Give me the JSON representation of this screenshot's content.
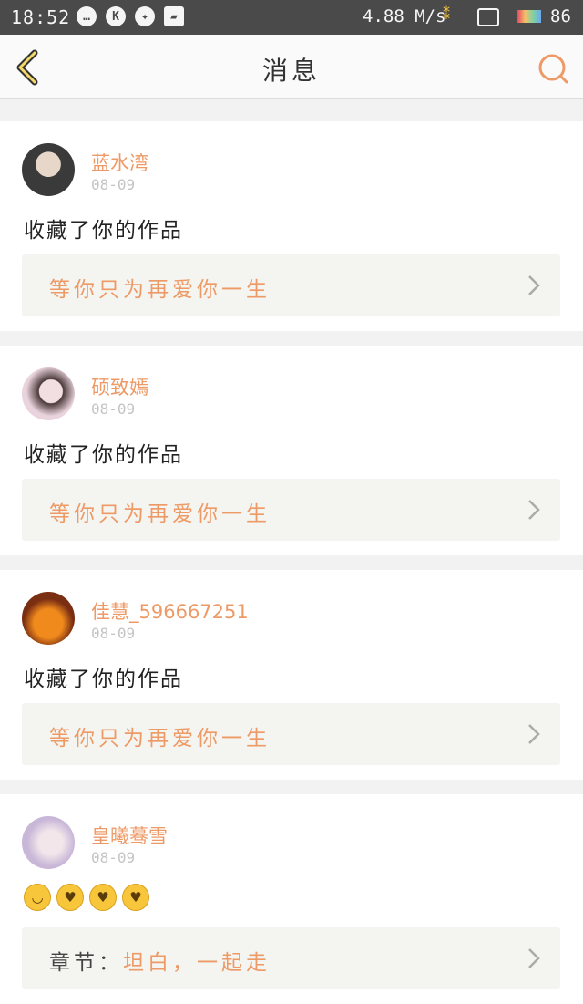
{
  "status_bar": {
    "time": "18:52",
    "net_speed": "4.88 M/s",
    "battery": "86",
    "icons": [
      "chat-icon",
      "k-icon",
      "aperture-icon",
      "image-icon"
    ]
  },
  "header": {
    "title": "消息"
  },
  "colors": {
    "accent": "#ee9a66",
    "link_bg": "#f4f4f0"
  },
  "messages": [
    {
      "username": "蓝水湾",
      "date": "08-09",
      "action": "收藏了你的作品",
      "work_title": "等你只为再爱你一生",
      "avatar_colors": [
        "#3a3a3a",
        "#e7d7c9"
      ]
    },
    {
      "username": "硕致嫣",
      "date": "08-09",
      "action": "收藏了你的作品",
      "work_title": "等你只为再爱你一生",
      "avatar_colors": [
        "#e9d3dc",
        "#4a3a3a"
      ]
    },
    {
      "username": "佳慧_596667251",
      "date": "08-09",
      "action": "收藏了你的作品",
      "work_title": "等你只为再爱你一生",
      "avatar_colors": [
        "#7a2e12",
        "#f08a1c"
      ]
    },
    {
      "username": "皇曦蓦雪",
      "date": "08-09",
      "emoji_names": [
        "grinning-face-icon",
        "kissing-heart-icon",
        "kissing-heart-icon",
        "kissing-heart-icon"
      ],
      "work_prefix": "章节：",
      "work_title": "坦白，一起走",
      "avatar_colors": [
        "#c9b7d8",
        "#f2e6ea"
      ]
    }
  ]
}
